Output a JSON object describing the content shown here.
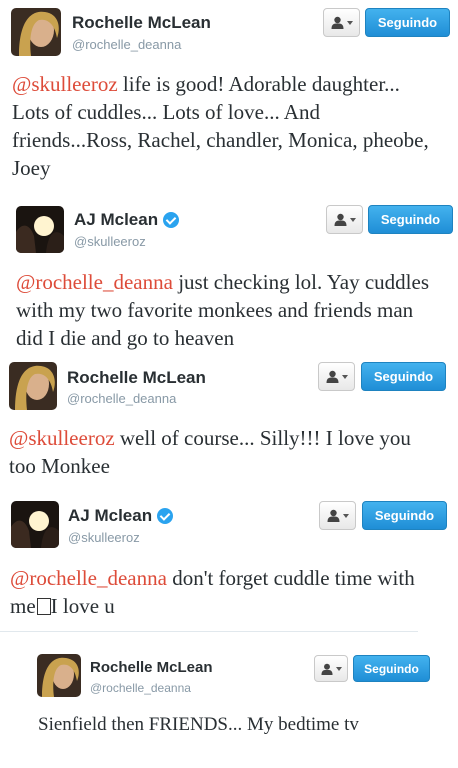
{
  "tweets": [
    {
      "name": "Rochelle McLean",
      "handle": "@rochelle_deanna",
      "verified": false,
      "follow_label": "Seguindo",
      "mention": "@skulleeroz",
      "text": " life is good! Adorable daughter... Lots of cuddles... Lots of love... And friends...Ross, Rachel, chandler, Monica, pheobe, Joey"
    },
    {
      "name": "AJ Mclean",
      "handle": "@skulleeroz",
      "verified": true,
      "follow_label": "Seguindo",
      "mention": "@rochelle_deanna",
      "text": " just checking lol. Yay cuddles with my two favorite monkees and friends man did I die and go to heaven"
    },
    {
      "name": "Rochelle McLean",
      "handle": "@rochelle_deanna",
      "verified": false,
      "follow_label": "Seguindo",
      "mention": "@skulleeroz",
      "text": " well of course... Silly!!! I love you too Monkee"
    },
    {
      "name": "AJ Mclean",
      "handle": "@skulleeroz",
      "verified": true,
      "follow_label": "Seguindo",
      "mention": "@rochelle_deanna",
      "text": " don't forget cuddle time with me",
      "text_after_box": "I love u"
    },
    {
      "name": "Rochelle McLean",
      "handle": "@rochelle_deanna",
      "verified": false,
      "follow_label": "Seguindo",
      "mention": "",
      "text": "Sienfield then FRIENDS... My bedtime tv"
    }
  ],
  "colors": {
    "mention": "#dd4b39",
    "follow_button": "#2b9be2",
    "verified_badge": "#2aa3ef",
    "handle": "#8899a6"
  },
  "icons": {
    "user_actions": "user-dropdown-icon",
    "verified": "verified-badge-icon"
  }
}
